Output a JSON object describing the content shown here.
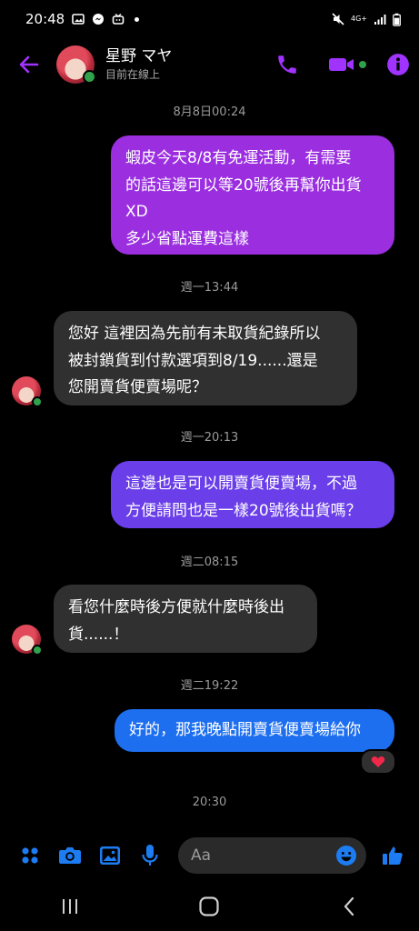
{
  "status_bar": {
    "time": "20:48",
    "network_label": "4G+",
    "left_icons": [
      "gallery-icon",
      "messenger-icon",
      "tv-icon",
      "dot-icon"
    ],
    "right_icons": [
      "mute-icon",
      "network-icon",
      "signal-icon",
      "battery-icon"
    ]
  },
  "header": {
    "name": "星野 マヤ",
    "status": "目前在線上",
    "accent": "#a033ff"
  },
  "messages": [
    {
      "type": "time",
      "text": "8月8日00:24"
    },
    {
      "type": "out",
      "text": "蝦皮今天8/8有免運活動，有需要\n的話這邊可以等20號後再幫你出貨\nXD\n多少省點運費這樣",
      "color": "#9b2fe0"
    },
    {
      "type": "time",
      "text": "週一13:44"
    },
    {
      "type": "in",
      "text": "您好 這裡因為先前有未取貨紀錄所以\n被封鎖貨到付款選項到8/19......還是\n您開賣貨便賣場呢？"
    },
    {
      "type": "time",
      "text": "週一20:13"
    },
    {
      "type": "out",
      "text": "這邊也是可以開賣貨便賣場，不過\n方便請問也是一樣20號後出貨嗎？",
      "color": "#6a3ee8"
    },
    {
      "type": "time",
      "text": "週二08:15"
    },
    {
      "type": "in",
      "text": "看您什麼時後方便就什麼時後出\n貨......！"
    },
    {
      "type": "time",
      "text": "週二19:22"
    },
    {
      "type": "out",
      "text": "好的，那我晚點開賣貨便賣場給你",
      "color": "#1d6ff0",
      "reaction": "heart"
    },
    {
      "type": "time",
      "text": "20:30"
    }
  ],
  "composer": {
    "placeholder": "Aa",
    "icons": [
      "apps-icon",
      "camera-icon",
      "image-icon",
      "mic-icon",
      "emoji-icon",
      "like-icon"
    ],
    "accent": "#1d7cf2"
  },
  "nav": {
    "icons": [
      "recents-icon",
      "home-icon",
      "back-nav-icon"
    ]
  }
}
